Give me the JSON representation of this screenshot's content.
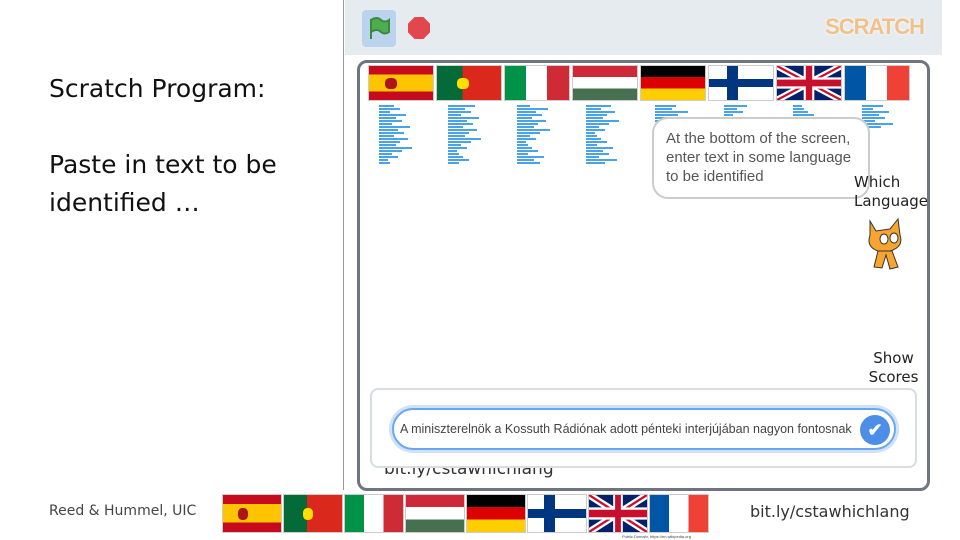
{
  "slide": {
    "title": "Scratch Program:",
    "subtitle": "Paste in text to be identified …",
    "footer_left": "Reed & Hummel, UIC",
    "footer_right": "bit.ly/cstawhichlang",
    "image_credit": "Public Domain, https://en.wikipedia.org"
  },
  "scratch": {
    "logo": "SCRATCH",
    "green_flag_icon": "green-flag-icon",
    "stop_icon": "stop-sign-icon"
  },
  "stage": {
    "flags": [
      "spain",
      "portugal",
      "italy",
      "hungary",
      "germany",
      "finland",
      "uk",
      "france"
    ],
    "bubble": "At the bottom of the screen, enter text in some language to be identified",
    "which_language": "Which Language?",
    "show_scores": "Show Scores",
    "link": "bit.ly/cstawhichlang",
    "answer_value": "A miniszterelnök a Kossuth Rádiónak adott pénteki interjújában nagyon fontosnak"
  },
  "bottom_flags": [
    "spain",
    "portugal",
    "italy",
    "hungary",
    "germany",
    "finland",
    "uk",
    "france"
  ],
  "colors": {
    "accent": "#4c8ee8",
    "stage_border": "#6f7580",
    "bar": "#4aa3e8"
  }
}
